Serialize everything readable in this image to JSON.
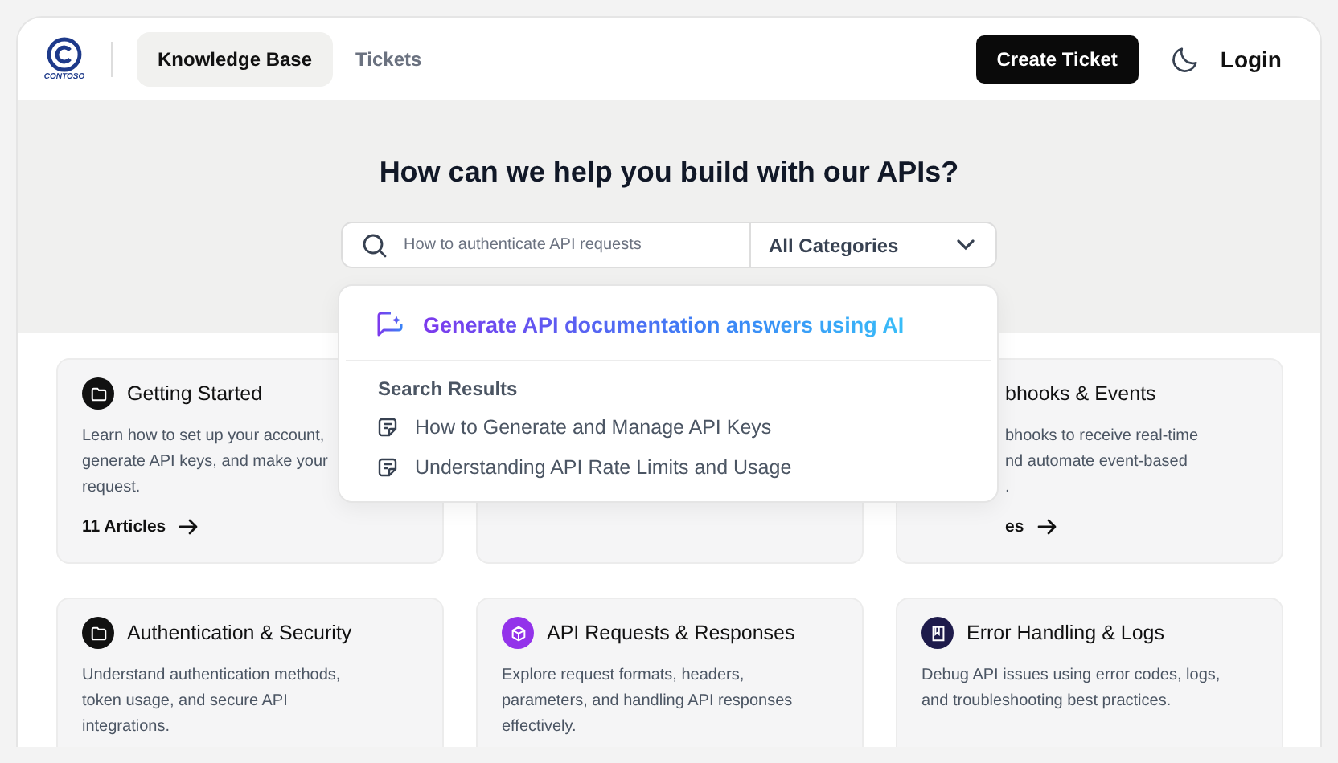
{
  "header": {
    "logo_text": "CONTOSO",
    "tabs": [
      {
        "label": "Knowledge Base",
        "selected": true
      },
      {
        "label": "Tickets",
        "selected": false
      }
    ],
    "create_button": "Create Ticket",
    "login": "Login"
  },
  "hero": {
    "title": "How can we help you build with our APIs?",
    "search": {
      "placeholder": "How to authenticate API requests"
    },
    "category_select": "All Categories"
  },
  "dropdown": {
    "ai_action": "Generate API documentation answers using AI",
    "results_heading": "Search Results",
    "results": [
      "How to Generate and Manage API Keys",
      "Understanding API Rate Limits and Usage"
    ]
  },
  "category_cards": [
    {
      "kind": "folder",
      "color": "#111111",
      "title": "Getting Started",
      "description_lines": [
        "Learn how to set up your account,",
        "generate API keys, and make your",
        "request."
      ],
      "link": "11 Articles"
    },
    {
      "kind": "covered"
    },
    {
      "kind": "clipped",
      "title": "bhooks & Events",
      "description_lines": [
        "bhooks to receive real-time",
        "nd automate event-based",
        "."
      ],
      "link": "es"
    },
    {
      "kind": "folder",
      "color": "#111111",
      "title": "Authentication & Security",
      "description_lines": [
        "Understand authentication methods,",
        "token usage, and secure API",
        "integrations."
      ]
    },
    {
      "kind": "cube",
      "color": "#9333ea",
      "title": "API Requests & Responses",
      "description_lines": [
        "Explore request formats, headers,",
        "parameters, and handling API responses",
        "effectively."
      ]
    },
    {
      "kind": "book",
      "color": "#1e1b4b",
      "title": "Error Handling & Logs",
      "description_lines": [
        "Debug API issues using error codes, logs,",
        "and troubleshooting best practices."
      ]
    }
  ]
}
